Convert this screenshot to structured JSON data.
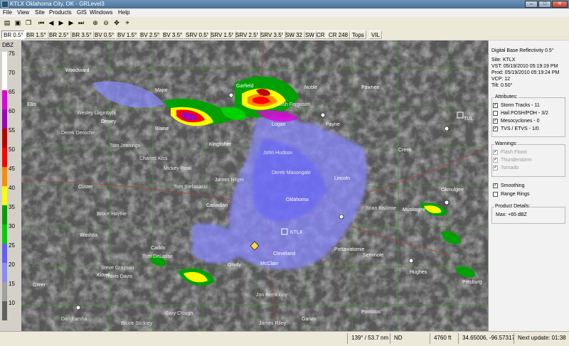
{
  "window": {
    "title": "KTLX Oklahoma City, OK - GRLevel3",
    "minimize": "–",
    "maximize": "□",
    "close": "✕"
  },
  "menu": [
    "File",
    "View",
    "Site",
    "Products",
    "GIS",
    "Windows",
    "Help"
  ],
  "toolbar_icons": [
    "open-icon",
    "save-icon",
    "copy-icon",
    "first-frame-icon",
    "prev-frame-icon",
    "play-icon",
    "next-frame-icon",
    "last-frame-icon",
    "zoom-in-icon",
    "zoom-out-icon",
    "pan-icon",
    "crosshair-icon"
  ],
  "products": [
    "BR 0.5°",
    "BR 1.5°",
    "BR 2.5°",
    "BR 3.5°",
    "BV 0.5°",
    "BV 1.5°",
    "BV 2.5°",
    "BV 3.5°",
    "SRV 0.5°",
    "SRV 1.5°",
    "SRV 2.5°",
    "SRV 3.5°",
    "SW 32",
    "SW",
    "CR",
    "CR 248",
    "Tops",
    "VIL"
  ],
  "active_product": "BR 0.5°",
  "legend": {
    "title": "DBZ",
    "labels": [
      "75",
      "70",
      "65",
      "60",
      "55",
      "50",
      "45",
      "40",
      "35",
      "30",
      "25",
      "20",
      "15",
      "10"
    ],
    "colors": [
      "#ffffff",
      "#ffffff",
      "#e000e0",
      "#a000c0",
      "#c00000",
      "#ff0000",
      "#ff8c00",
      "#ffff00",
      "#00a000",
      "#00d000",
      "#6060ff",
      "#8a8aff",
      "#a0a0a0",
      "#606060"
    ]
  },
  "panel": {
    "product": "Digital Base Reflectivity 0.5°",
    "site": "Site:  KTLX",
    "vst": "VST:  05/19/2010  05:19:19 PM",
    "prod": "Prod: 05/19/2010  05:19:24 PM",
    "vcp": "VCP:  12",
    "tilt": "Tilt:   0.50°",
    "attributes_title": "Attributes:",
    "attributes": [
      {
        "label": "Storm Tracks - 11",
        "checked": true
      },
      {
        "label": "Hail POSH/POH - 3/2",
        "checked": false
      },
      {
        "label": "Mesocyclones - 0",
        "checked": true
      },
      {
        "label": "TVS / ETVS - 1/0",
        "checked": true
      }
    ],
    "warnings_title": "Warnings:",
    "warnings": [
      {
        "label": "Flash Flood",
        "checked": true
      },
      {
        "label": "Thunderstorm",
        "checked": true
      },
      {
        "label": "Tornado",
        "checked": true
      }
    ],
    "smoothing": {
      "label": "Smoothing",
      "checked": true
    },
    "range_rings": {
      "label": "Range Rings",
      "checked": false
    },
    "details_title": "Product Details:",
    "details_max": "Max:     +65 dBZ"
  },
  "map": {
    "counties": [
      {
        "name": "Woodward"
      },
      {
        "name": "Ellis"
      },
      {
        "name": "Major"
      },
      {
        "name": "Garfield"
      },
      {
        "name": "Noble"
      },
      {
        "name": "Pawnee"
      },
      {
        "name": "Payne"
      },
      {
        "name": "Logan"
      },
      {
        "name": "Creek"
      },
      {
        "name": "Lincoln"
      },
      {
        "name": "Okmulgee"
      },
      {
        "name": "Muskogee"
      },
      {
        "name": "Custer"
      },
      {
        "name": "Washita"
      },
      {
        "name": "Caddo"
      },
      {
        "name": "Canadian"
      },
      {
        "name": "Oklahoma"
      },
      {
        "name": "Cleveland"
      },
      {
        "name": "McClain"
      },
      {
        "name": "Pottawatomie"
      },
      {
        "name": "Seminole"
      },
      {
        "name": "Hughes"
      },
      {
        "name": "Pittsburg"
      },
      {
        "name": "Greer"
      },
      {
        "name": "Kiowa"
      },
      {
        "name": "Garvin"
      },
      {
        "name": "Pontotoc"
      },
      {
        "name": "Grady"
      },
      {
        "name": "Kingfisher"
      },
      {
        "name": "Dewey"
      },
      {
        "name": "Blaine"
      }
    ],
    "spotters": [
      "Wesley Luginbyhl",
      "Derek Deroche",
      "Tom Jennings",
      "Charles Kiss",
      "Tom Stefanacci",
      "James Hilger",
      "Derek Masongale",
      "Bruce Haynie",
      "Tom DeLasse",
      "Steve Grayson",
      "Travis Davis",
      "Dan Farsha",
      "Bruce Stickley",
      "Gary Clough",
      "Jon Berrickloy",
      "James Riley",
      "Brian Kallinne",
      "Mickey Peak",
      "Josh Ferguson",
      "John Hudson"
    ],
    "site_label": "KTLX",
    "other_site": "TUL"
  },
  "status": {
    "bearing": "139° / 53.7 nm",
    "nd": "ND",
    "height": "4760 ft",
    "latlon": "34.65006, -96.57317",
    "next_update": "Next update: 01:38"
  }
}
